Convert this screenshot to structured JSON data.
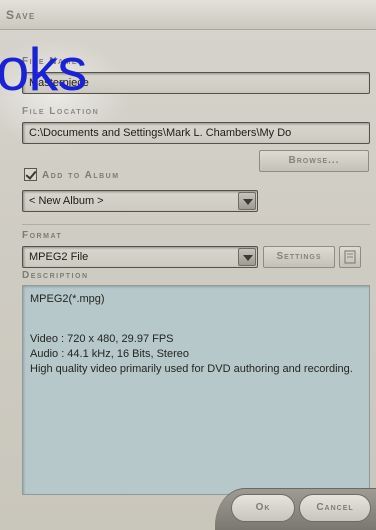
{
  "dialog": {
    "title": "Save"
  },
  "file_name": {
    "label": "File Name",
    "value": "Masterpiece"
  },
  "file_location": {
    "label": "File Location",
    "value": "C:\\Documents and Settings\\Mark L. Chambers\\My Do",
    "browse_label": "Browse..."
  },
  "album": {
    "checkbox_label": "Add to Album",
    "checked": true,
    "selected": "< New Album >"
  },
  "format": {
    "label": "Format",
    "selected": "MPEG2 File",
    "settings_label": "Settings"
  },
  "description": {
    "label": "Description",
    "line1": "MPEG2(*.mpg)",
    "video": "Video : 720 x 480,  29.97 FPS",
    "audio": "Audio : 44.1 kHz,  16 Bits,  Stereo",
    "summary": "High quality video primarily used for DVD authoring and recording."
  },
  "actions": {
    "ok_label": "Ok",
    "cancel_label": "Cancel"
  },
  "overlay": {
    "text": "oks"
  },
  "colors": {
    "overlay_text": "#1b22d6",
    "description_bg": "#b7c8cb",
    "panel_bg": "#cfccc3"
  }
}
